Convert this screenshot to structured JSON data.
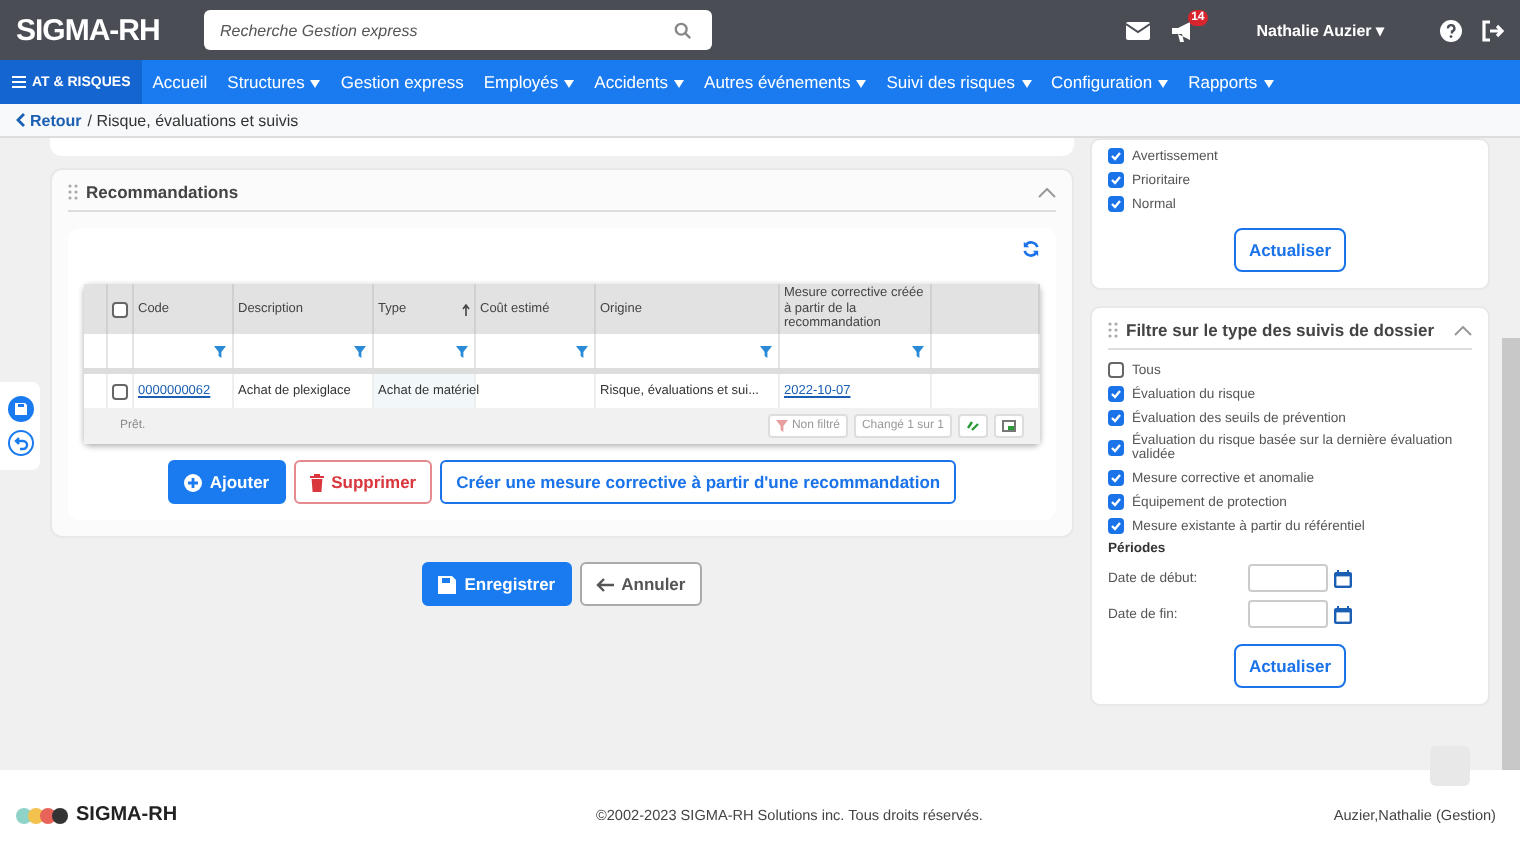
{
  "header": {
    "logo": "SIGMA-RH",
    "search": {
      "placeholder": "Recherche Gestion express"
    },
    "notification_count": "14",
    "user": "Nathalie Auzier ▾"
  },
  "nav": {
    "module": "AT & RISQUES",
    "items": [
      {
        "label": "Accueil",
        "dropdown": false
      },
      {
        "label": "Structures",
        "dropdown": true
      },
      {
        "label": "Gestion express",
        "dropdown": false
      },
      {
        "label": "Employés",
        "dropdown": true
      },
      {
        "label": "Accidents",
        "dropdown": true
      },
      {
        "label": "Autres événements",
        "dropdown": true
      },
      {
        "label": "Suivi des risques",
        "dropdown": true
      },
      {
        "label": "Configuration",
        "dropdown": true
      },
      {
        "label": "Rapports",
        "dropdown": true
      }
    ]
  },
  "breadcrumb": {
    "back": "Retour",
    "current": "/ Risque, évaluations et suivis"
  },
  "recommendations": {
    "title": "Recommandations",
    "columns": [
      "Code",
      "Description",
      "Type",
      "Coût estimé",
      "Origine",
      "Mesure corrective créée à partir de la recommandation"
    ],
    "select_all_checked": false,
    "rows": [
      {
        "selected": false,
        "cells": [
          "0000000062",
          "Achat de plexiglace",
          "Achat de matériel",
          "",
          "Risque, évaluations et sui...",
          "2022-10-07"
        ]
      }
    ],
    "status": "Prêt.",
    "filter_state": "Non filtré",
    "change_state": "Changé 1 sur 1",
    "buttons": [
      {
        "kind": "primary",
        "label": "Ajouter"
      },
      {
        "kind": "danger",
        "label": "Supprimer"
      },
      {
        "kind": "outline",
        "label": "Créer une mesure corrective à partir d'une recommandation"
      }
    ]
  },
  "form_buttons": [
    {
      "kind": "primary",
      "label": "Enregistrer"
    },
    {
      "kind": "secondary",
      "label": "Annuler"
    }
  ],
  "priority_filter": {
    "options": [
      {
        "label": "Avertissement",
        "checked": true
      },
      {
        "label": "Prioritaire",
        "checked": true
      },
      {
        "label": "Normal",
        "checked": true
      }
    ],
    "button": "Actualiser"
  },
  "type_filter": {
    "title": "Filtre sur le type des suivis de dossier",
    "options": [
      {
        "label": "Tous",
        "checked": false
      },
      {
        "label": "Évaluation du risque",
        "checked": true
      },
      {
        "label": "Évaluation des seuils de prévention",
        "checked": true
      },
      {
        "label": "Évaluation du risque basée sur la dernière évaluation validée",
        "checked": true
      },
      {
        "label": "Mesure corrective et anomalie",
        "checked": true
      },
      {
        "label": "Équipement de protection",
        "checked": true
      },
      {
        "label": "Mesure existante à partir du référentiel",
        "checked": true
      }
    ],
    "periods_label": "Périodes",
    "start_label": "Date de début:",
    "end_label": "Date de fin:",
    "button": "Actualiser"
  },
  "footer": {
    "logo": "SIGMA-RH",
    "copyright": "©2002-2023 SIGMA-RH Solutions inc. Tous droits réservés.",
    "user": "Auzier,Nathalie (Gestion)"
  }
}
